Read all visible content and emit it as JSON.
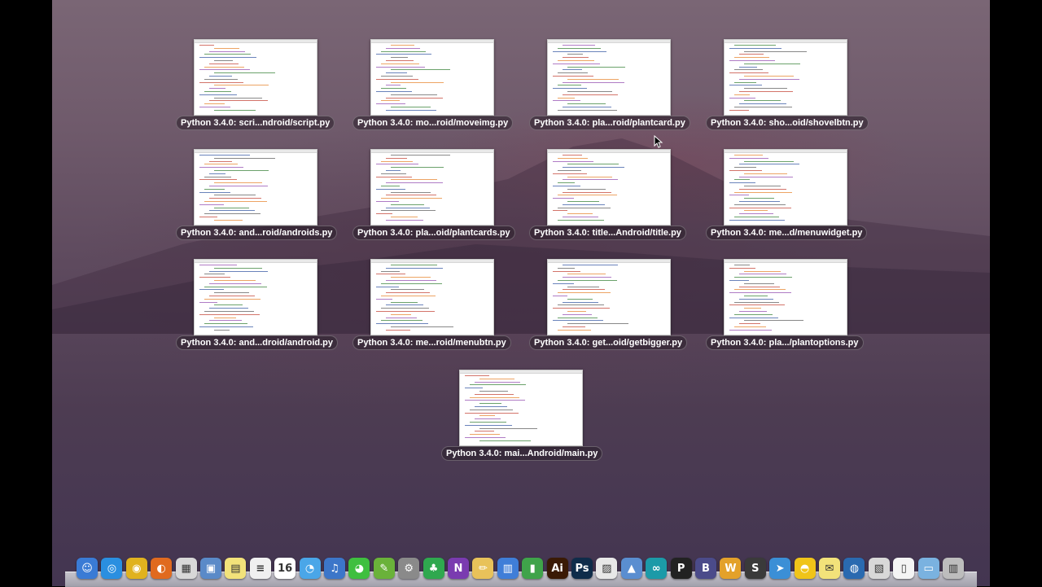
{
  "windows": [
    {
      "title": "Python 3.4.0: scri...ndroid/script.py"
    },
    {
      "title": "Python 3.4.0: mo...roid/moveimg.py"
    },
    {
      "title": "Python 3.4.0: pla...roid/plantcard.py"
    },
    {
      "title": "Python 3.4.0: sho...oid/shovelbtn.py"
    },
    {
      "title": "Python 3.4.0: and...roid/androids.py"
    },
    {
      "title": "Python 3.4.0: pla...oid/plantcards.py"
    },
    {
      "title": "Python 3.4.0: title...Android/title.py"
    },
    {
      "title": "Python 3.4.0: me...d/menuwidget.py"
    },
    {
      "title": "Python 3.4.0: and...droid/android.py"
    },
    {
      "title": "Python 3.4.0: me...roid/menubtn.py"
    },
    {
      "title": "Python 3.4.0: get...oid/getbigger.py"
    },
    {
      "title": "Python 3.4.0: pla.../plantoptions.py"
    },
    {
      "title": "Python 3.4.0: mai...Android/main.py"
    }
  ],
  "dock": {
    "items": [
      {
        "icon": "finder-icon",
        "color": "#3a7bd5",
        "glyph": "☺"
      },
      {
        "icon": "safari-icon",
        "color": "#2a8fe0",
        "glyph": "◎"
      },
      {
        "icon": "chrome-icon",
        "color": "#e0b21f",
        "glyph": "◉"
      },
      {
        "icon": "firefox-icon",
        "color": "#e06a1f",
        "glyph": "◐"
      },
      {
        "icon": "launchpad-icon",
        "color": "#d8d8d8",
        "glyph": "▦"
      },
      {
        "icon": "preview-icon",
        "color": "#5a8ac8",
        "glyph": "▣"
      },
      {
        "icon": "stickies-icon",
        "color": "#f2e27a",
        "glyph": "▤"
      },
      {
        "icon": "textedit-icon",
        "color": "#f0f0f0",
        "glyph": "≡"
      },
      {
        "icon": "calendar-icon",
        "color": "#ffffff",
        "glyph": "16"
      },
      {
        "icon": "messages-icon",
        "color": "#4aa6e8",
        "glyph": "◔"
      },
      {
        "icon": "itunes-icon",
        "color": "#3c76c9",
        "glyph": "♫"
      },
      {
        "icon": "wechat-icon",
        "color": "#3fbf3f",
        "glyph": "◕"
      },
      {
        "icon": "utility-icon",
        "color": "#6ab23a",
        "glyph": "✎"
      },
      {
        "icon": "settings-icon",
        "color": "#8a8a8a",
        "glyph": "⚙"
      },
      {
        "icon": "evernote-icon",
        "color": "#2fa84f",
        "glyph": "♣"
      },
      {
        "icon": "onenote-icon",
        "color": "#7a3bb0",
        "glyph": "N"
      },
      {
        "icon": "pencil-icon",
        "color": "#e8c25a",
        "glyph": "✏"
      },
      {
        "icon": "keynote-icon",
        "color": "#3f7ed8",
        "glyph": "▥"
      },
      {
        "icon": "numbers-icon",
        "color": "#3fa34a",
        "glyph": "▮"
      },
      {
        "icon": "illustrator-icon",
        "color": "#3a1a05",
        "glyph": "Ai"
      },
      {
        "icon": "photoshop-icon",
        "color": "#0f2c4a",
        "glyph": "Ps"
      },
      {
        "icon": "document-icon",
        "color": "#e8e8e8",
        "glyph": "▨"
      },
      {
        "icon": "xcode-icon",
        "color": "#5a8ed0",
        "glyph": "▲"
      },
      {
        "icon": "arduino-icon",
        "color": "#1c9aa8",
        "glyph": "∞"
      },
      {
        "icon": "p-app-icon",
        "color": "#222222",
        "glyph": "P"
      },
      {
        "icon": "bbedit-icon",
        "color": "#4b4b8a",
        "glyph": "B"
      },
      {
        "icon": "w-app-icon",
        "color": "#e3a12a",
        "glyph": "W"
      },
      {
        "icon": "sublime-icon",
        "color": "#3a3a3a",
        "glyph": "S"
      },
      {
        "icon": "bird-icon",
        "color": "#3b8fd6",
        "glyph": "➤"
      },
      {
        "icon": "cyberduck-icon",
        "color": "#f0c419",
        "glyph": "◓"
      },
      {
        "icon": "notes-icon",
        "color": "#f2e27a",
        "glyph": "✉"
      },
      {
        "icon": "quicktime-icon",
        "color": "#2a6ab0",
        "glyph": "◍"
      },
      {
        "icon": "preview-doc-icon",
        "color": "#d8d8d8",
        "glyph": "▧"
      },
      {
        "icon": "file-icon",
        "color": "#f4f4f4",
        "glyph": "▯"
      },
      {
        "icon": "folder-icon",
        "color": "#7ab2e0",
        "glyph": "▭"
      },
      {
        "icon": "trash-icon",
        "color": "#bdbdbd",
        "glyph": "▥"
      }
    ]
  }
}
